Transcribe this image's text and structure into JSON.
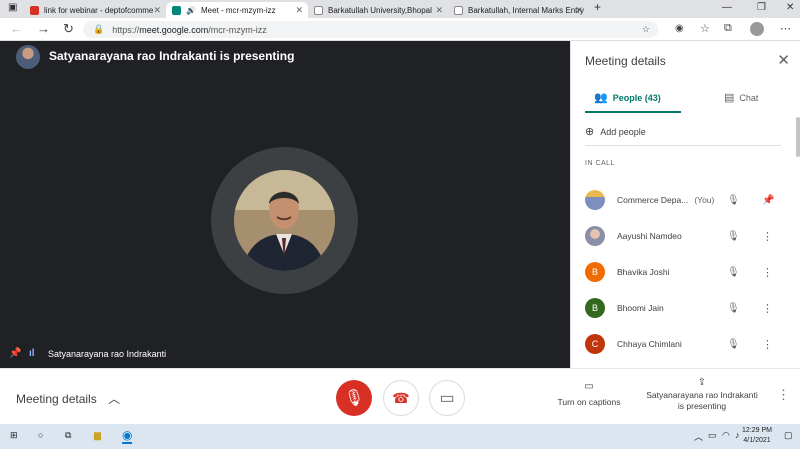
{
  "browser": {
    "tabs": [
      {
        "title": "link for webinar - deptofcomme",
        "favicon_color": "#d93025"
      },
      {
        "title": "Meet - mcr-mzym-izz",
        "favicon_color": "#00897b",
        "active": true
      },
      {
        "title": "Barkatullah University,Bhopal",
        "favicon_color": "#5f6368"
      },
      {
        "title": "Barkatullah, Internal Marks Entry",
        "favicon_color": "#5f6368"
      }
    ],
    "url_prefix": "https://",
    "url_domain": "meet.google.com",
    "url_path": "/mcr-mzym-izz"
  },
  "stage": {
    "presenting_text": "Satyanarayana rao Indrakanti is presenting",
    "tile_name": "Satyanarayana rao Indrakanti"
  },
  "panel": {
    "title": "Meeting details",
    "people_tab": "People (43)",
    "chat_tab": "Chat",
    "add_people": "Add people",
    "in_call": "IN CALL",
    "participants": [
      {
        "initial": "",
        "name": "Commerce Depa...",
        "you": "(You)",
        "color": "#9aa6c8",
        "image": true
      },
      {
        "initial": "",
        "name": "Aayushi Namdeo",
        "you": "",
        "color": "#b7a9c4",
        "image": true
      },
      {
        "initial": "B",
        "name": "Bhavika Joshi",
        "you": "",
        "color": "#ef6c00"
      },
      {
        "initial": "B",
        "name": "Bhoomi Jain",
        "you": "",
        "color": "#33691e"
      },
      {
        "initial": "C",
        "name": "Chhaya Chimlani",
        "you": "",
        "color": "#bf360c"
      }
    ]
  },
  "bottom": {
    "meeting_details": "Meeting details",
    "captions": "Turn on captions",
    "presenting": "Satyanarayana rao Indrakanti is presenting"
  },
  "taskbar": {
    "time": "12:29 PM",
    "date": "4/1/2021"
  }
}
